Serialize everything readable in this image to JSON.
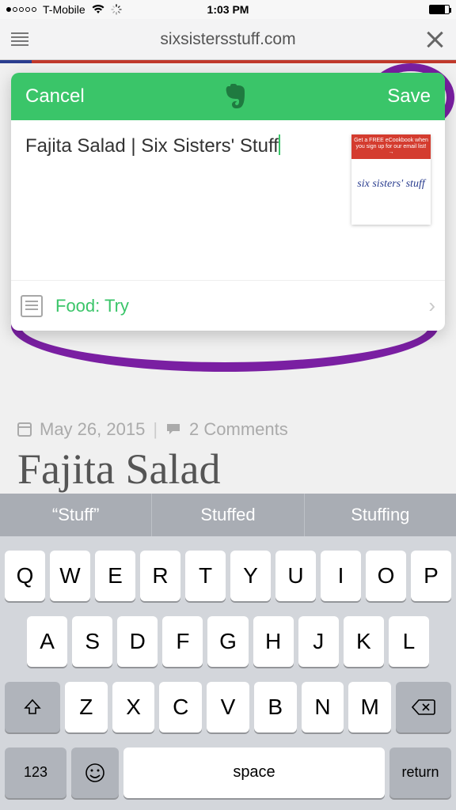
{
  "status": {
    "carrier": "T-Mobile",
    "time": "1:03 PM"
  },
  "browser": {
    "url": "sixsistersstuff.com"
  },
  "dialog": {
    "cancel_label": "Cancel",
    "save_label": "Save",
    "note_title": "Fajita Salad | Six Sisters' Stuff",
    "thumb_banner": "Get a FREE eCookbook when you sign up for our email list! →",
    "thumb_logo_a": "six sisters'",
    "thumb_logo_b": "stuff",
    "notebook_label": "Food: Try"
  },
  "page": {
    "date": "May 26, 2015",
    "comments_label": "2 Comments",
    "title": "Fajita Salad"
  },
  "keyboard": {
    "suggestions": [
      "“Stuff”",
      "Stuffed",
      "Stuffing"
    ],
    "row1": [
      "Q",
      "W",
      "E",
      "R",
      "T",
      "Y",
      "U",
      "I",
      "O",
      "P"
    ],
    "row2": [
      "A",
      "S",
      "D",
      "F",
      "G",
      "H",
      "J",
      "K",
      "L"
    ],
    "row3": [
      "Z",
      "X",
      "C",
      "V",
      "B",
      "N",
      "M"
    ],
    "num_label": "123",
    "space_label": "space",
    "return_label": "return"
  }
}
